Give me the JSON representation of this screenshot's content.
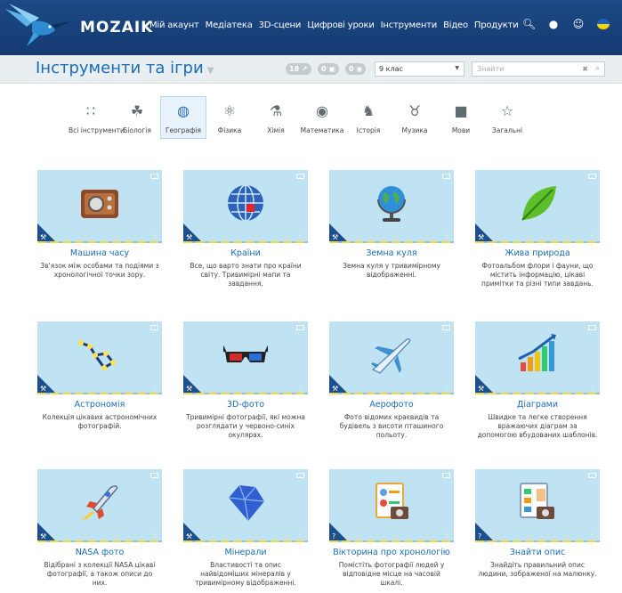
{
  "nav": {
    "logo": "MOZAIK",
    "links": [
      "Мій акаунт",
      "Медіатека",
      "3D-сцени",
      "Цифрові уроки",
      "Інструменти",
      "Відео",
      "Продукти"
    ]
  },
  "header": {
    "title": "Інструменти та ігри",
    "pills": [
      "18",
      "0",
      "0"
    ],
    "grade": "9 клас",
    "search_placeholder": "Знайти"
  },
  "categories": [
    {
      "label": "Всі інструменти",
      "icon": "grid-icon"
    },
    {
      "label": "Біологія",
      "icon": "plant-icon"
    },
    {
      "label": "Географія",
      "icon": "globe-icon",
      "active": true
    },
    {
      "label": "Фізика",
      "icon": "atom-icon"
    },
    {
      "label": "Хімія",
      "icon": "flask-icon"
    },
    {
      "label": "Математика",
      "icon": "sphere-icon"
    },
    {
      "label": "Історія",
      "icon": "helmet-icon"
    },
    {
      "label": "Музика",
      "icon": "lyre-icon"
    },
    {
      "label": "Мови",
      "icon": "speech-icon"
    },
    {
      "label": "Загальні",
      "icon": "star-icon"
    }
  ],
  "cards": [
    {
      "title": "Машина часу",
      "desc": "Зв'язок між особами та подіями з хронологічної точки зору.",
      "icon": "radio-icon"
    },
    {
      "title": "Країни",
      "desc": "Все, що варто знати про країни світу. Тривимірні мапи та завдання.",
      "icon": "globe-grid-icon"
    },
    {
      "title": "Земна куля",
      "desc": "Земна куля у тривимірному відображенні.",
      "icon": "earth-globe-icon"
    },
    {
      "title": "Жива природа",
      "desc": "Фотоальбом флори і фауни, що містить інформацію, цікаві примітки та різні типи завдань.",
      "icon": "leaf-icon"
    },
    {
      "title": "Астрономія",
      "desc": "Колекція цікавих астрономічних фотографій.",
      "icon": "constellation-icon"
    },
    {
      "title": "3D-фото",
      "desc": "Тривимірні фотографії, які можна розглядати у червоно-синіх окулярах.",
      "icon": "3d-glasses-icon"
    },
    {
      "title": "Аерофото",
      "desc": "Фото відомих краєвидів та будівель з висоти пташиного польоту.",
      "icon": "airplane-icon"
    },
    {
      "title": "Діаграми",
      "desc": "Швидке та легке створення вражаючих діаграм за допомогою вбудованих шаблонів.",
      "icon": "bar-chart-icon"
    },
    {
      "title": "NASA фото",
      "desc": "Відібрані з колекції NASA цікаві фотографії, а також описи до них.",
      "icon": "rocket-icon"
    },
    {
      "title": "Мінерали",
      "desc": "Властивості та опис найвідоміших мінералів у тривимірному відображенні.",
      "icon": "diamond-icon"
    },
    {
      "title": "Вікторина про хронологію",
      "desc": "Помістіть фотографії людей у відповідне місце на часовій шкалі.",
      "icon": "quiz-board-icon"
    },
    {
      "title": "Знайти опис",
      "desc": "Знайдіть правильний опис людини, зображеної на малюнку.",
      "icon": "id-card-icon"
    }
  ]
}
